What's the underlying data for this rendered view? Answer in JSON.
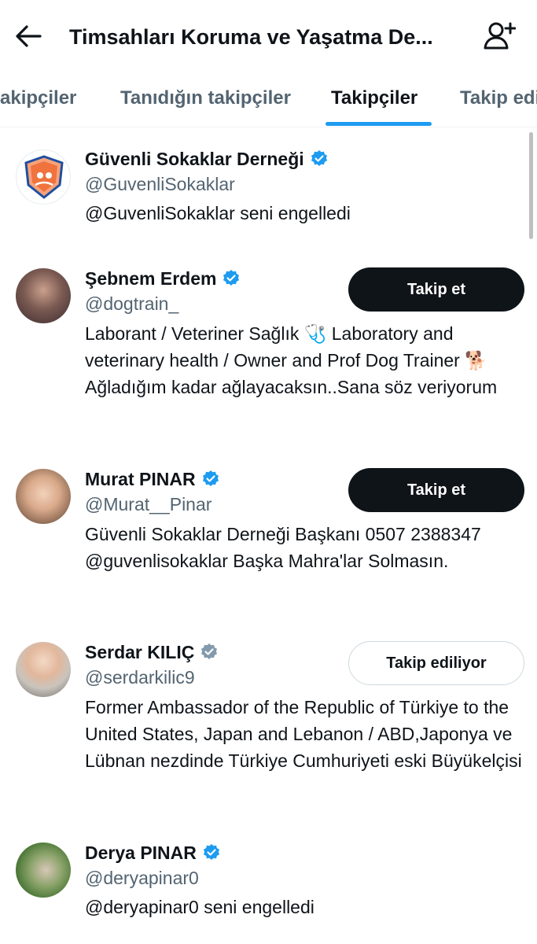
{
  "header": {
    "title": "Timsahları Koruma ve Yaşatma De...",
    "back_icon": "arrow-left-icon",
    "add_icon": "person-add-icon"
  },
  "tabs": [
    {
      "label": "takipçiler"
    },
    {
      "label": "Tanıdığın takipçiler"
    },
    {
      "label": "Takipçiler"
    },
    {
      "label": "Takip edilenler"
    }
  ],
  "colors": {
    "accent": "#1d9bf0",
    "verified": "#1d9bf0",
    "button_dark": "#0f1419",
    "secondary_text": "#536471"
  },
  "users": [
    {
      "name": "Güvenli Sokaklar Derneği",
      "handle": "@GuvenliSokaklar",
      "bio": "@GuvenliSokaklar seni engelledi",
      "button": "",
      "avatar": "logo-avatar"
    },
    {
      "name": "Şebnem Erdem",
      "handle": "@dogtrain_",
      "bio": "Laborant / Veteriner Sağlık 🩺 Laboratory and veterinary health / Owner and Prof Dog Trainer 🐕 Ağladığım kadar ağlayacaksın..Sana söz veriyorum",
      "button": "Takip et",
      "avatar": "photo-avatar"
    },
    {
      "name": "Murat PINAR",
      "handle": "@Murat__Pinar",
      "bio": "Güvenli Sokaklar Derneği Başkanı 0507 2388347 @guvenlisokaklar Başka Mahra'lar Solmasın.",
      "button": "Takip et",
      "avatar": "photo-avatar"
    },
    {
      "name": "Serdar KILIÇ",
      "handle": "@serdarkilic9",
      "bio": "Former Ambassador of the Republic of Türkiye to the United States, Japan and Lebanon / ABD,Japonya ve Lübnan nezdinde Türkiye Cumhuriyeti eski Büyükelçisi",
      "button": "Takip ediliyor",
      "avatar": "photo-avatar"
    },
    {
      "name": "Derya PINAR",
      "handle": "@deryapinar0",
      "bio": "@deryapinar0 seni engelledi",
      "button": "",
      "avatar": "photo-avatar"
    }
  ]
}
